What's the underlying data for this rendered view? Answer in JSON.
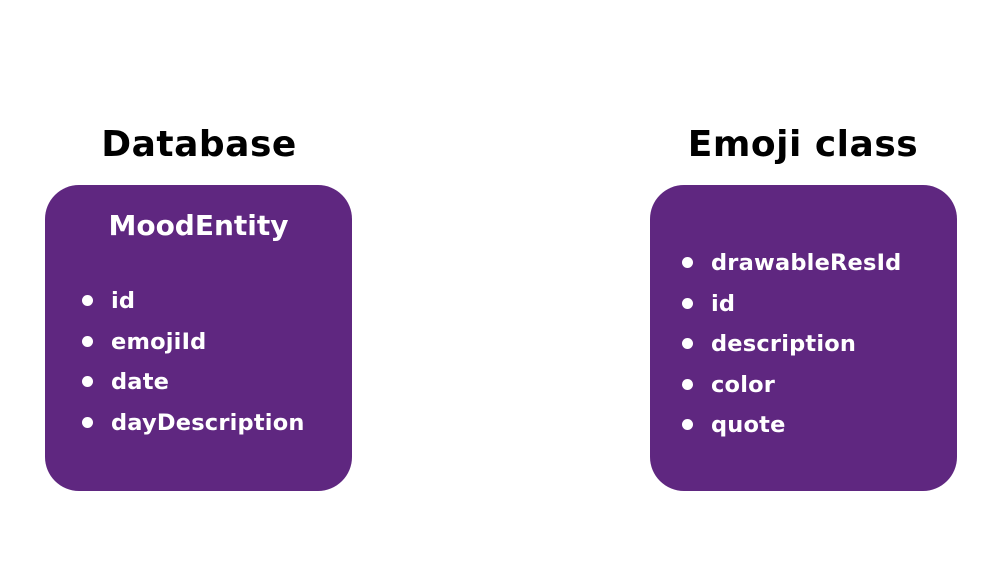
{
  "left_panel": {
    "title": "Database",
    "card": {
      "heading": "MoodEntity",
      "fields": [
        "id",
        "emojiId",
        "date",
        "dayDescription"
      ]
    }
  },
  "right_panel": {
    "title": "Emoji class",
    "card": {
      "fields": [
        "drawableResId",
        "id",
        "description",
        "color",
        "quote"
      ]
    }
  },
  "colors": {
    "card_background": "#5f2780",
    "card_text": "#ffffff",
    "title_text": "#000000"
  }
}
